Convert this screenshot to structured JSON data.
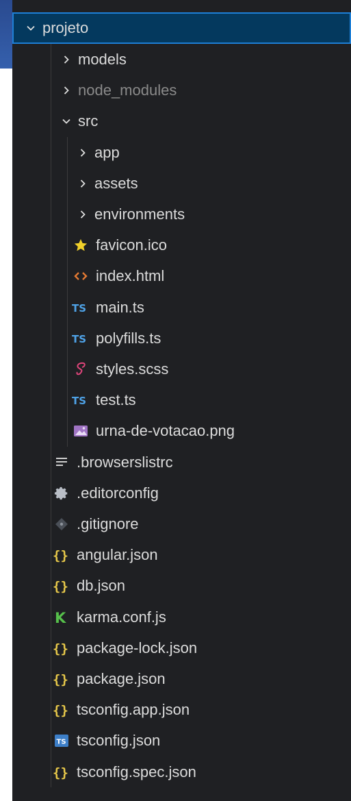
{
  "explorer": {
    "root": {
      "label": "projeto",
      "expanded": true
    },
    "items": [
      {
        "label": "models",
        "type": "folder",
        "depth": 1,
        "icon": "chevron-right-icon"
      },
      {
        "label": "node_modules",
        "type": "folder",
        "depth": 1,
        "icon": "chevron-right-icon",
        "dimmed": true
      },
      {
        "label": "src",
        "type": "folder-open",
        "depth": 1,
        "icon": "chevron-down-icon"
      },
      {
        "label": "app",
        "type": "folder",
        "depth": 2,
        "icon": "chevron-right-icon"
      },
      {
        "label": "assets",
        "type": "folder",
        "depth": 2,
        "icon": "chevron-right-icon"
      },
      {
        "label": "environments",
        "type": "folder",
        "depth": 2,
        "icon": "chevron-right-icon"
      },
      {
        "label": "favicon.ico",
        "type": "file",
        "depth": 2,
        "icon": "star-icon"
      },
      {
        "label": "index.html",
        "type": "file",
        "depth": 2,
        "icon": "html-icon"
      },
      {
        "label": "main.ts",
        "type": "file",
        "depth": 2,
        "icon": "typescript-icon"
      },
      {
        "label": "polyfills.ts",
        "type": "file",
        "depth": 2,
        "icon": "typescript-icon"
      },
      {
        "label": "styles.scss",
        "type": "file",
        "depth": 2,
        "icon": "sass-icon"
      },
      {
        "label": "test.ts",
        "type": "file",
        "depth": 2,
        "icon": "typescript-icon"
      },
      {
        "label": "urna-de-votacao.png",
        "type": "file",
        "depth": 2,
        "icon": "image-icon"
      },
      {
        "label": ".browserslistrc",
        "type": "file",
        "depth": 1,
        "icon": "lines-icon"
      },
      {
        "label": ".editorconfig",
        "type": "file",
        "depth": 1,
        "icon": "gear-icon"
      },
      {
        "label": ".gitignore",
        "type": "file",
        "depth": 1,
        "icon": "git-icon",
        "dimmed": false
      },
      {
        "label": "angular.json",
        "type": "file",
        "depth": 1,
        "icon": "json-icon"
      },
      {
        "label": "db.json",
        "type": "file",
        "depth": 1,
        "icon": "json-icon"
      },
      {
        "label": "karma.conf.js",
        "type": "file",
        "depth": 1,
        "icon": "karma-icon"
      },
      {
        "label": "package-lock.json",
        "type": "file",
        "depth": 1,
        "icon": "json-icon"
      },
      {
        "label": "package.json",
        "type": "file",
        "depth": 1,
        "icon": "json-icon"
      },
      {
        "label": "tsconfig.app.json",
        "type": "file",
        "depth": 1,
        "icon": "json-icon"
      },
      {
        "label": "tsconfig.json",
        "type": "file",
        "depth": 1,
        "icon": "tsconfig-icon"
      },
      {
        "label": "tsconfig.spec.json",
        "type": "file",
        "depth": 1,
        "icon": "json-icon"
      }
    ],
    "icon_glyphs": {
      "ts": "TS",
      "json": "{}",
      "html": "<>",
      "karma": "K",
      "star": "★"
    }
  },
  "colors": {
    "panel_bg": "#1f2023",
    "selection_bg": "#04395e",
    "selection_border": "#1e7fd6",
    "text": "#dcdcdc",
    "dim_text": "#8a8a8a",
    "ts_blue": "#4fa3e8",
    "json_yellow": "#e8c94a",
    "html_orange": "#e37933",
    "sass_pink": "#e0457b",
    "karma_green": "#56c04b",
    "star_yellow": "#f2d12a",
    "image_purple": "#a074c4"
  }
}
